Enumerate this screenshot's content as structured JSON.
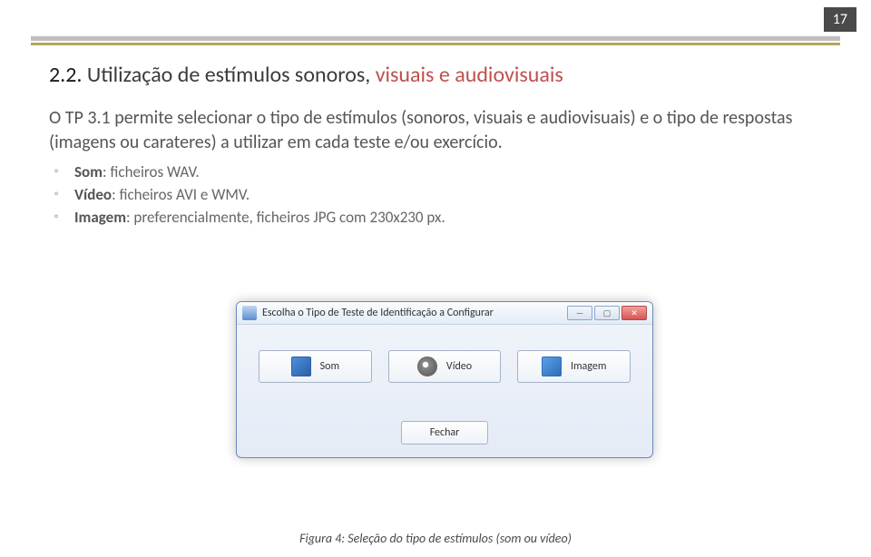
{
  "page_number": "17",
  "heading": {
    "number": "2.2. ",
    "plain": "Utilização de estímulos sonoros, ",
    "highlight": "visuais e audiovisuais"
  },
  "paragraph": "O TP 3.1 permite selecionar o tipo de estímulos (sonoros, visuais e audiovisuais) e o tipo de respostas (imagens ou carateres) a utilizar em cada teste e/ou exercício.",
  "bullets": [
    {
      "label": "Som",
      "rest": ": ficheiros WAV."
    },
    {
      "label": "Vídeo",
      "rest": ": ficheiros AVI e WMV."
    },
    {
      "label": "Imagem",
      "rest": ": preferencialmente,  ficheiros JPG com 230x230 px."
    }
  ],
  "dialog": {
    "title": "Escolha o Tipo de Teste de Identificação a Configurar",
    "buttons": {
      "som": "Som",
      "video": "Vídeo",
      "imagem": "Imagem"
    },
    "close": "Fechar"
  },
  "caption": "Figura 4: Seleção do tipo de estímulos (som ou vídeo)"
}
